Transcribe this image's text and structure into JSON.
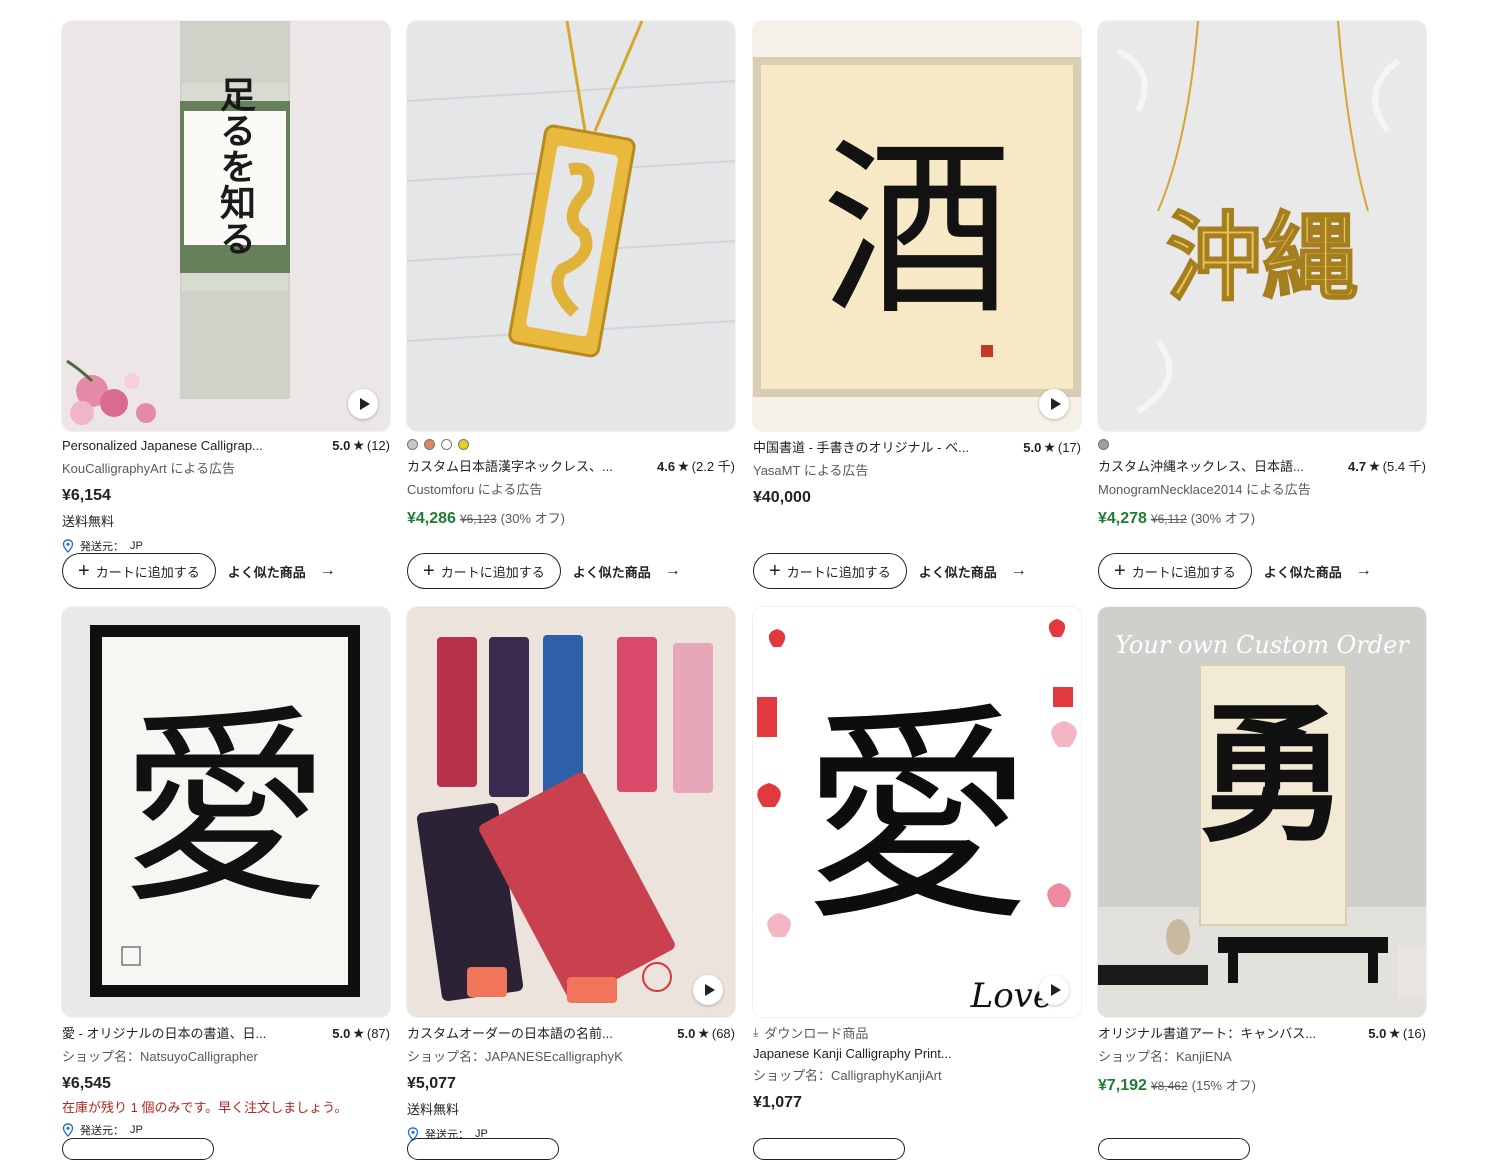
{
  "ui": {
    "cart_label": "カートに追加する",
    "similar_label": "よく似た商品",
    "origin_prefix": "発送元：",
    "play_icon": "play-icon",
    "star_icon": "star-icon",
    "location_icon": "location-pin-icon"
  },
  "colors": {
    "sale_green": "#1e7d34",
    "stock_red": "#b3261e",
    "text_dark": "#222222",
    "text_muted": "#595959"
  },
  "row1": [
    {
      "title": "Personalized Japanese Calligrap...",
      "rating": "5.0",
      "reviews": "(12)",
      "shop": "KouCalligraphyArt による広告",
      "price": "¥6,154",
      "shipping": "送料無料",
      "origin": "JP",
      "image_text": "足るを知る"
    },
    {
      "swatches": [
        "#c8c8c8",
        "#d9896a",
        "#ffffff",
        "#e8cc22"
      ],
      "title": "カスタム日本語漢字ネックレス、...",
      "rating": "4.6",
      "reviews": "(2.2 千)",
      "shop": "Customforu による広告",
      "price": "¥4,286",
      "original_price": "¥6,123",
      "discount": "(30% オフ)"
    },
    {
      "title": "中国書道 - 手書きのオリジナル - ベ...",
      "rating": "5.0",
      "reviews": "(17)",
      "shop": "YasaMT による広告",
      "price": "¥40,000",
      "image_text": "酒"
    },
    {
      "swatches": [
        "#9e9e9e"
      ],
      "title": "カスタム沖縄ネックレス、日本語...",
      "rating": "4.7",
      "reviews": "(5.4 千)",
      "shop": "MonogramNecklace2014 による広告",
      "price": "¥4,278",
      "original_price": "¥6,112",
      "discount": "(30% オフ)",
      "image_text": "沖縄"
    }
  ],
  "row2": [
    {
      "title": "愛 - オリジナルの日本の書道、日...",
      "rating": "5.0",
      "reviews": "(87)",
      "shop": "ショップ名：NatsuyoCalligrapher",
      "price": "¥6,545",
      "stock": "在庫が残り 1 個のみです。早く注文しましょう。",
      "origin": "JP",
      "image_text": "愛"
    },
    {
      "title": "カスタムオーダーの日本語の名前...",
      "rating": "5.0",
      "reviews": "(68)",
      "shop": "ショップ名：JAPANESEcalligraphyK",
      "price": "¥5,077",
      "shipping": "送料無料",
      "origin": "JP"
    },
    {
      "download": "ダウンロード商品",
      "title": "Japanese Kanji Calligraphy Print...",
      "shop": "ショップ名：CalligraphyKanjiArt",
      "price": "¥1,077",
      "image_text": "愛",
      "image_script": "Love"
    },
    {
      "title": "オリジナル書道アート：キャンバス...",
      "rating": "5.0",
      "reviews": "(16)",
      "shop": "ショップ名：KanjiENA",
      "price": "¥7,192",
      "original_price": "¥8,462",
      "discount": "(15% オフ)",
      "image_text": "勇",
      "image_script": "Your own Custom Order"
    }
  ]
}
